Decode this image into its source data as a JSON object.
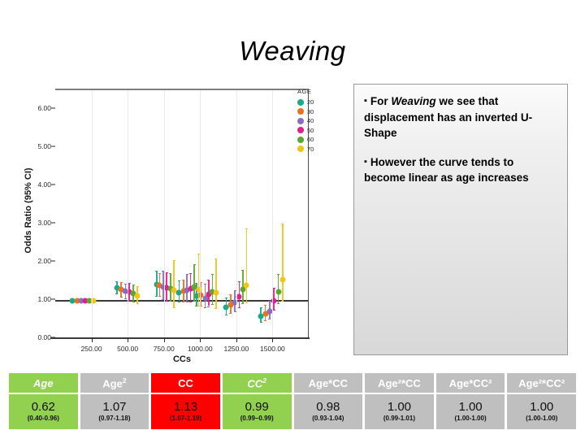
{
  "slide": {
    "title": "Weaving"
  },
  "callout": {
    "bullet_glyph": "▪",
    "paragraphs": [
      {
        "pre": "For ",
        "emphasis": "Weaving",
        "post": " we see that displacement has an inverted U-Shape"
      },
      {
        "pre": "However the curve tends to become linear as age increases",
        "emphasis": "",
        "post": ""
      }
    ]
  },
  "chart_data": {
    "type": "scatter",
    "title": "",
    "xlabel": "CCs",
    "ylabel": "Odds Ratio (95% CI)",
    "xlim": [
      0,
      1750
    ],
    "ylim": [
      0,
      6.5
    ],
    "x_ticks": [
      "250.00",
      "500.00",
      "750.00",
      "1000.00",
      "1250.00",
      "1500.00"
    ],
    "x_tick_values": [
      250,
      500,
      750,
      1000,
      1250,
      1500
    ],
    "y_ticks": [
      "0.00",
      "1.00",
      "2.00",
      "3.00",
      "4.00",
      "5.00",
      "6.00"
    ],
    "y_tick_values": [
      0,
      1,
      2,
      3,
      4,
      5,
      6
    ],
    "grid": false,
    "reference_line_y": 1.0,
    "legend": {
      "title": "AGE",
      "position": "right",
      "entries": [
        {
          "label": "20",
          "color": "#1aa98a"
        },
        {
          "label": "30",
          "color": "#e8731c"
        },
        {
          "label": "40",
          "color": "#8a6fbd"
        },
        {
          "label": "50",
          "color": "#e0218a"
        },
        {
          "label": "60",
          "color": "#5aa832"
        },
        {
          "label": "70",
          "color": "#f0c419"
        }
      ]
    },
    "series": [
      {
        "name": "20",
        "color": "#1aa98a",
        "points": [
          {
            "x": 120,
            "y": 1.0,
            "lo": 1.0,
            "hi": 1.0
          },
          {
            "x": 425,
            "y": 1.33,
            "lo": 1.18,
            "hi": 1.51
          },
          {
            "x": 700,
            "y": 1.42,
            "lo": 1.13,
            "hi": 1.78
          },
          {
            "x": 855,
            "y": 1.22,
            "lo": 0.97,
            "hi": 1.52
          },
          {
            "x": 975,
            "y": 1.13,
            "lo": 0.88,
            "hi": 1.46
          },
          {
            "x": 1180,
            "y": 0.83,
            "lo": 0.64,
            "hi": 1.08
          },
          {
            "x": 1420,
            "y": 0.6,
            "lo": 0.45,
            "hi": 0.82
          }
        ]
      },
      {
        "name": "30",
        "color": "#e8731c",
        "points": [
          {
            "x": 150,
            "y": 1.0,
            "lo": 1.0,
            "hi": 1.0
          },
          {
            "x": 455,
            "y": 1.29,
            "lo": 1.11,
            "hi": 1.48
          },
          {
            "x": 720,
            "y": 1.4,
            "lo": 1.12,
            "hi": 1.72
          },
          {
            "x": 885,
            "y": 1.25,
            "lo": 0.98,
            "hi": 1.55
          },
          {
            "x": 1005,
            "y": 1.14,
            "lo": 0.88,
            "hi": 1.48
          },
          {
            "x": 1210,
            "y": 0.89,
            "lo": 0.68,
            "hi": 1.16
          },
          {
            "x": 1450,
            "y": 0.66,
            "lo": 0.49,
            "hi": 0.9
          }
        ]
      },
      {
        "name": "40",
        "color": "#8a6fbd",
        "points": [
          {
            "x": 180,
            "y": 1.0,
            "lo": 1.0,
            "hi": 1.0
          },
          {
            "x": 485,
            "y": 1.26,
            "lo": 1.06,
            "hi": 1.45
          },
          {
            "x": 745,
            "y": 1.36,
            "lo": 1.05,
            "hi": 1.79
          },
          {
            "x": 910,
            "y": 1.28,
            "lo": 0.97,
            "hi": 1.7
          },
          {
            "x": 1035,
            "y": 1.07,
            "lo": 0.82,
            "hi": 1.44
          },
          {
            "x": 1240,
            "y": 0.96,
            "lo": 0.72,
            "hi": 1.27
          },
          {
            "x": 1480,
            "y": 0.73,
            "lo": 0.54,
            "hi": 1.0
          }
        ]
      },
      {
        "name": "50",
        "color": "#e0218a",
        "points": [
          {
            "x": 208,
            "y": 1.0,
            "lo": 1.0,
            "hi": 1.0
          },
          {
            "x": 512,
            "y": 1.23,
            "lo": 1.02,
            "hi": 1.46
          },
          {
            "x": 770,
            "y": 1.34,
            "lo": 1.0,
            "hi": 1.74
          },
          {
            "x": 935,
            "y": 1.32,
            "lo": 0.98,
            "hi": 1.72
          },
          {
            "x": 1060,
            "y": 1.16,
            "lo": 0.86,
            "hi": 1.55
          },
          {
            "x": 1270,
            "y": 1.1,
            "lo": 0.82,
            "hi": 1.5
          },
          {
            "x": 1510,
            "y": 0.99,
            "lo": 0.76,
            "hi": 1.34
          }
        ]
      },
      {
        "name": "60",
        "color": "#5aa832",
        "points": [
          {
            "x": 235,
            "y": 1.0,
            "lo": 1.0,
            "hi": 1.0
          },
          {
            "x": 540,
            "y": 1.18,
            "lo": 0.98,
            "hi": 1.42
          },
          {
            "x": 795,
            "y": 1.31,
            "lo": 0.99,
            "hi": 1.72
          },
          {
            "x": 960,
            "y": 1.35,
            "lo": 1.0,
            "hi": 1.96
          },
          {
            "x": 1085,
            "y": 1.24,
            "lo": 0.92,
            "hi": 1.7
          },
          {
            "x": 1295,
            "y": 1.29,
            "lo": 0.94,
            "hi": 1.8
          },
          {
            "x": 1540,
            "y": 1.23,
            "lo": 0.93,
            "hi": 1.69
          }
        ]
      },
      {
        "name": "70",
        "color": "#f0c419",
        "points": [
          {
            "x": 262,
            "y": 1.0,
            "lo": 1.0,
            "hi": 1.0
          },
          {
            "x": 568,
            "y": 1.13,
            "lo": 0.93,
            "hi": 1.39
          },
          {
            "x": 820,
            "y": 1.27,
            "lo": 0.82,
            "hi": 2.05
          },
          {
            "x": 990,
            "y": 1.3,
            "lo": 0.87,
            "hi": 2.22
          },
          {
            "x": 1110,
            "y": 1.22,
            "lo": 0.8,
            "hi": 2.1
          },
          {
            "x": 1320,
            "y": 1.4,
            "lo": 0.95,
            "hi": 2.88
          },
          {
            "x": 1570,
            "y": 1.55,
            "lo": 0.99,
            "hi": 3.02
          }
        ]
      }
    ]
  },
  "table": {
    "columns": [
      {
        "label": "Age",
        "sup": "",
        "italic": true,
        "color": "#92d050"
      },
      {
        "label": "Age",
        "sup": "2",
        "italic": false,
        "color": "#bfbfbf"
      },
      {
        "label": "CC",
        "sup": "",
        "italic": false,
        "color": "#ff0000"
      },
      {
        "label": "CC",
        "sup": "2",
        "italic": true,
        "color": "#92d050"
      },
      {
        "label": "Age*CC",
        "sup": "",
        "italic": false,
        "color": "#bfbfbf"
      },
      {
        "label": "Age²*CC",
        "sup": "",
        "italic": false,
        "color": "#bfbfbf"
      },
      {
        "label": "Age*CC²",
        "sup": "",
        "italic": false,
        "color": "#bfbfbf"
      },
      {
        "label": "Age²*CC²",
        "sup": "",
        "italic": false,
        "color": "#bfbfbf"
      }
    ],
    "row": [
      {
        "value": "0.62",
        "ci": "(0.40-0.96)",
        "color": "#92d050"
      },
      {
        "value": "1.07",
        "ci": "(0.97-1.18)",
        "color": "#bfbfbf"
      },
      {
        "value": "1.13",
        "ci": "(1.07-1.19)",
        "color": "#ff0000"
      },
      {
        "value": "0.99",
        "ci": "(0.99–0.99)",
        "color": "#92d050"
      },
      {
        "value": "0.98",
        "ci": "(0.93-1.04)",
        "color": "#bfbfbf"
      },
      {
        "value": "1.00",
        "ci": "(0.99-1.01)",
        "color": "#bfbfbf"
      },
      {
        "value": "1.00",
        "ci": "(1.00-1.00)",
        "color": "#bfbfbf"
      },
      {
        "value": "1.00",
        "ci": "(1.00-1.00)",
        "color": "#bfbfbf"
      }
    ]
  }
}
